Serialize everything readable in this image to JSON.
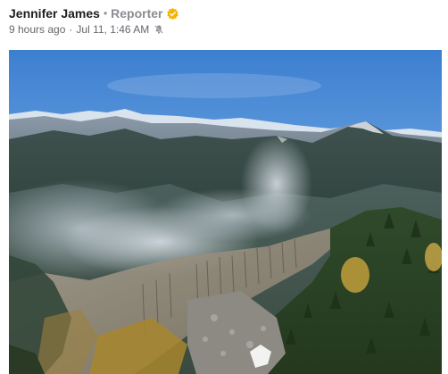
{
  "post": {
    "author_name": "Jennifer James",
    "separator_dot": "•",
    "author_role": "Reporter",
    "time_ago": "9 hours ago",
    "meta_separator": "·",
    "timestamp": "Jul 11, 1:46 AM",
    "icons": {
      "verified": "verified-badge-icon",
      "notifications": "bell-muted-icon"
    },
    "colors": {
      "verified_badge": "#f5b400",
      "secondary_text": "#65676b"
    },
    "photo": {
      "subject": "wildfire smoke over forested mountain ridge"
    }
  }
}
